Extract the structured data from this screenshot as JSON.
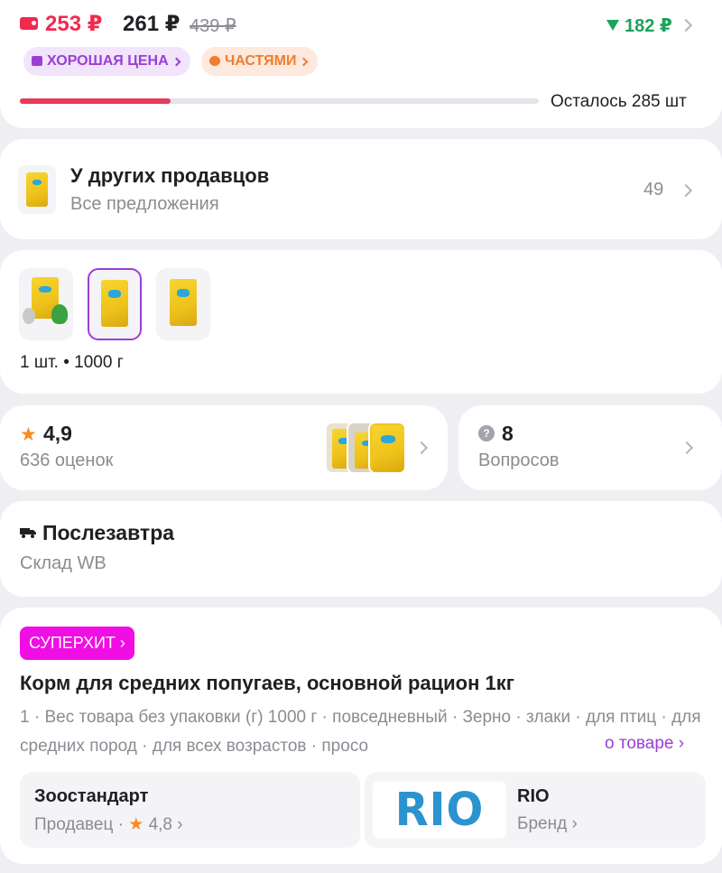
{
  "price": {
    "wallet_price": "253 ₽",
    "price": "261 ₽",
    "old_price": "439 ₽",
    "price_drop": "182 ₽",
    "stock_progress_percent": 29,
    "stock_left": "Осталось 285 шт"
  },
  "badges": {
    "good_price": "ХОРОШАЯ ЦЕНА",
    "installments": "ЧАСТЯМИ"
  },
  "sellers": {
    "title": "У других продавцов",
    "subtitle": "Все предложения",
    "count": "49"
  },
  "variants": {
    "caption": "1 шт. • 1000 г",
    "selected_index": 1
  },
  "rating": {
    "value": "4,9",
    "count": "636 оценок"
  },
  "questions": {
    "count": "8",
    "label": "Вопросов"
  },
  "delivery": {
    "title": "Послезавтра",
    "warehouse": "Склад WB"
  },
  "product": {
    "badge": "СУПЕРХИТ ›",
    "title": "Корм для средних попугаев, основной рацион 1кг",
    "description": "1 · Вес товара без упаковки (г) 1000 г · повседневный · Зерно · злаки · для птиц · для средних пород · для всех возрастов · просо",
    "about_link": "о товаре ›"
  },
  "seller": {
    "name": "Зоостандарт",
    "meta_prefix": "Продавец ·",
    "rating": "4,8 ›"
  },
  "brand": {
    "logo_text": "RIO",
    "name": "RIO",
    "meta": "Бренд ›"
  },
  "colors": {
    "accent": "#9b3ed6",
    "sale": "#f0294f",
    "discount_green": "#1aa35a",
    "superhit": "#f00ee4"
  }
}
